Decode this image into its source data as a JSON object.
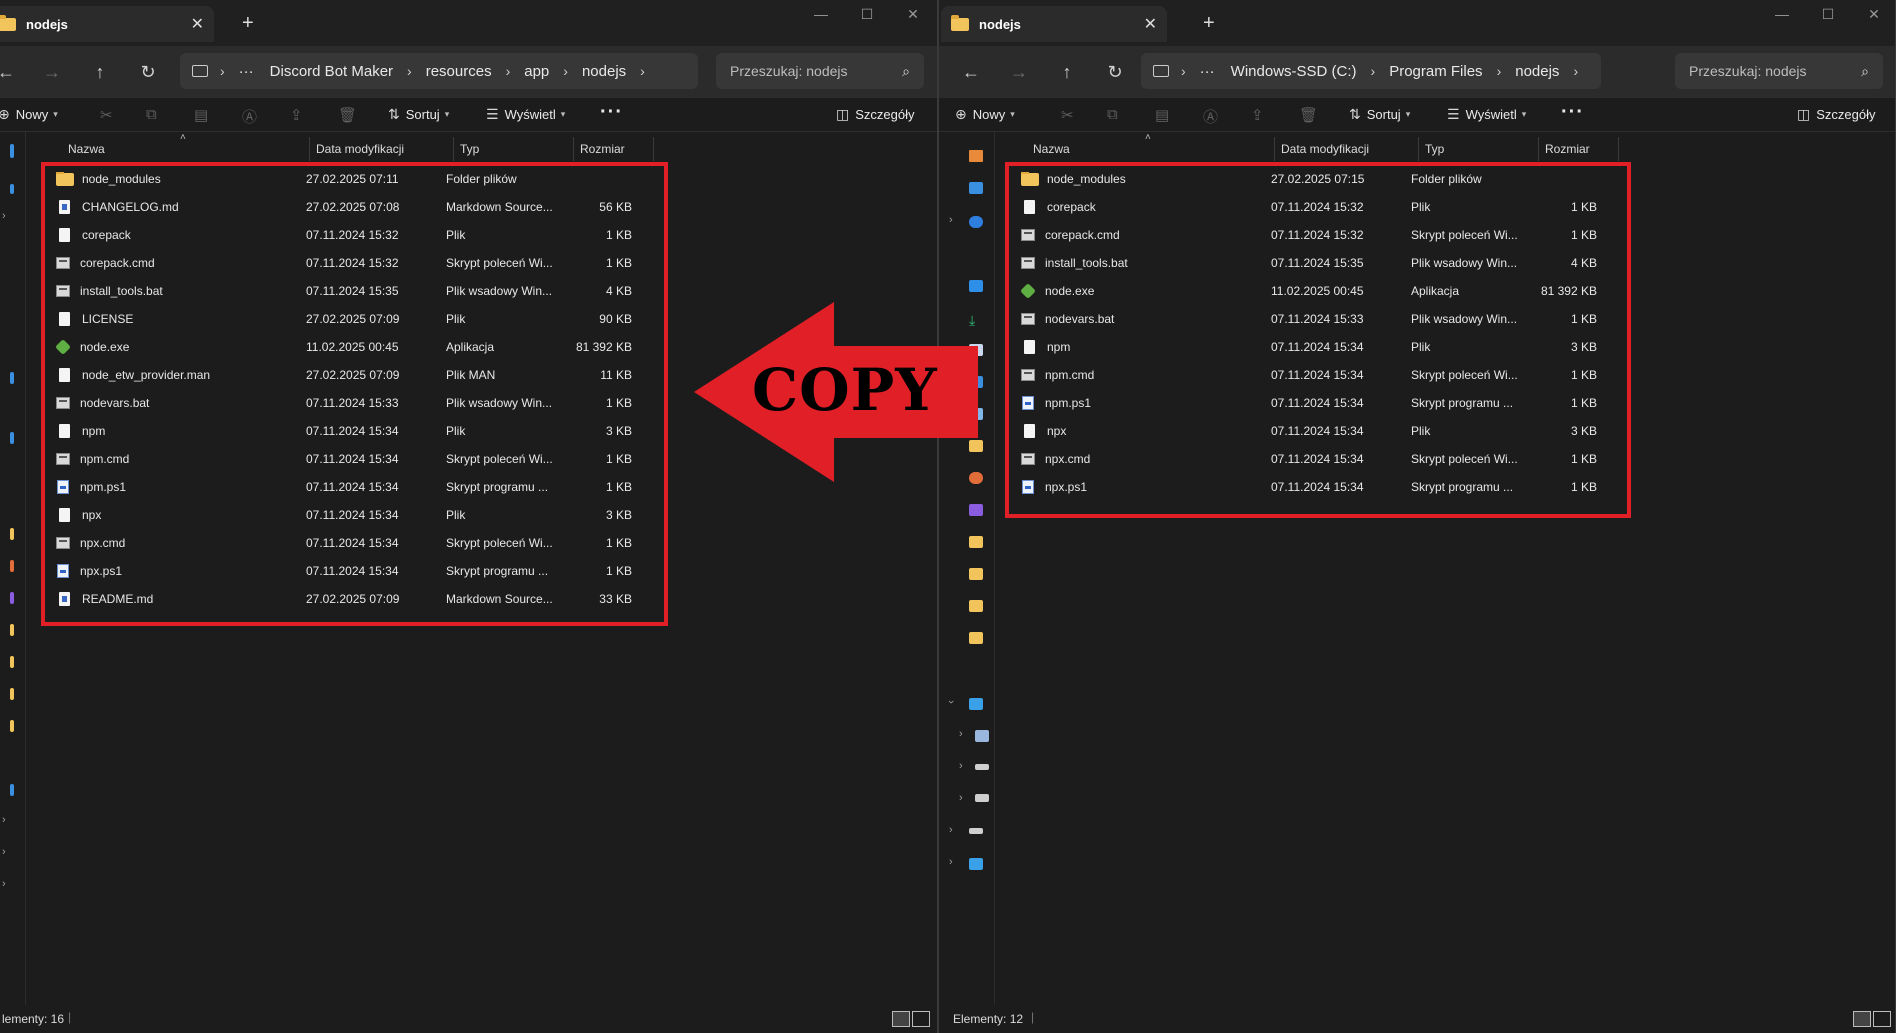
{
  "left": {
    "tab_title": "nodejs",
    "breadcrumb": [
      "Discord Bot Maker",
      "resources",
      "app",
      "nodejs"
    ],
    "search_placeholder": "Przeszukaj: nodejs",
    "toolbar": {
      "new": "Nowy",
      "sort": "Sortuj",
      "view": "Wyświetl",
      "details": "Szczegóły"
    },
    "columns": {
      "name": "Nazwa",
      "date": "Data modyfikacji",
      "type": "Typ",
      "size": "Rozmiar"
    },
    "files": [
      {
        "name": "node_modules",
        "date": "27.02.2025 07:11",
        "type": "Folder plików",
        "size": "",
        "icon": "folder"
      },
      {
        "name": "CHANGELOG.md",
        "date": "27.02.2025 07:08",
        "type": "Markdown Source...",
        "size": "56 KB",
        "icon": "md"
      },
      {
        "name": "corepack",
        "date": "07.11.2024 15:32",
        "type": "Plik",
        "size": "1 KB",
        "icon": "file"
      },
      {
        "name": "corepack.cmd",
        "date": "07.11.2024 15:32",
        "type": "Skrypt poleceń Wi...",
        "size": "1 KB",
        "icon": "script"
      },
      {
        "name": "install_tools.bat",
        "date": "07.11.2024 15:35",
        "type": "Plik wsadowy Win...",
        "size": "4 KB",
        "icon": "script"
      },
      {
        "name": "LICENSE",
        "date": "27.02.2025 07:09",
        "type": "Plik",
        "size": "90 KB",
        "icon": "file"
      },
      {
        "name": "node.exe",
        "date": "11.02.2025 00:45",
        "type": "Aplikacja",
        "size": "81 392 KB",
        "icon": "exe"
      },
      {
        "name": "node_etw_provider.man",
        "date": "27.02.2025 07:09",
        "type": "Plik MAN",
        "size": "11 KB",
        "icon": "file"
      },
      {
        "name": "nodevars.bat",
        "date": "07.11.2024 15:33",
        "type": "Plik wsadowy Win...",
        "size": "1 KB",
        "icon": "script"
      },
      {
        "name": "npm",
        "date": "07.11.2024 15:34",
        "type": "Plik",
        "size": "3 KB",
        "icon": "file"
      },
      {
        "name": "npm.cmd",
        "date": "07.11.2024 15:34",
        "type": "Skrypt poleceń Wi...",
        "size": "1 KB",
        "icon": "script"
      },
      {
        "name": "npm.ps1",
        "date": "07.11.2024 15:34",
        "type": "Skrypt programu ...",
        "size": "1 KB",
        "icon": "ps1"
      },
      {
        "name": "npx",
        "date": "07.11.2024 15:34",
        "type": "Plik",
        "size": "3 KB",
        "icon": "file"
      },
      {
        "name": "npx.cmd",
        "date": "07.11.2024 15:34",
        "type": "Skrypt poleceń Wi...",
        "size": "1 KB",
        "icon": "script"
      },
      {
        "name": "npx.ps1",
        "date": "07.11.2024 15:34",
        "type": "Skrypt programu ...",
        "size": "1 KB",
        "icon": "ps1"
      },
      {
        "name": "README.md",
        "date": "27.02.2025 07:09",
        "type": "Markdown Source...",
        "size": "33 KB",
        "icon": "md"
      }
    ],
    "status": "lementy: 16"
  },
  "right": {
    "tab_title": "nodejs",
    "breadcrumb": [
      "Windows-SSD (C:)",
      "Program Files",
      "nodejs"
    ],
    "search_placeholder": "Przeszukaj: nodejs",
    "toolbar": {
      "new": "Nowy",
      "sort": "Sortuj",
      "view": "Wyświetl",
      "details": "Szczegóły"
    },
    "columns": {
      "name": "Nazwa",
      "date": "Data modyfikacji",
      "type": "Typ",
      "size": "Rozmiar"
    },
    "files": [
      {
        "name": "node_modules",
        "date": "27.02.2025 07:15",
        "type": "Folder plików",
        "size": "",
        "icon": "folder"
      },
      {
        "name": "corepack",
        "date": "07.11.2024 15:32",
        "type": "Plik",
        "size": "1 KB",
        "icon": "file"
      },
      {
        "name": "corepack.cmd",
        "date": "07.11.2024 15:32",
        "type": "Skrypt poleceń Wi...",
        "size": "1 KB",
        "icon": "script"
      },
      {
        "name": "install_tools.bat",
        "date": "07.11.2024 15:35",
        "type": "Plik wsadowy Win...",
        "size": "4 KB",
        "icon": "script"
      },
      {
        "name": "node.exe",
        "date": "11.02.2025 00:45",
        "type": "Aplikacja",
        "size": "81 392 KB",
        "icon": "exe"
      },
      {
        "name": "nodevars.bat",
        "date": "07.11.2024 15:33",
        "type": "Plik wsadowy Win...",
        "size": "1 KB",
        "icon": "script"
      },
      {
        "name": "npm",
        "date": "07.11.2024 15:34",
        "type": "Plik",
        "size": "3 KB",
        "icon": "file"
      },
      {
        "name": "npm.cmd",
        "date": "07.11.2024 15:34",
        "type": "Skrypt poleceń Wi...",
        "size": "1 KB",
        "icon": "script"
      },
      {
        "name": "npm.ps1",
        "date": "07.11.2024 15:34",
        "type": "Skrypt programu ...",
        "size": "1 KB",
        "icon": "ps1"
      },
      {
        "name": "npx",
        "date": "07.11.2024 15:34",
        "type": "Plik",
        "size": "3 KB",
        "icon": "file"
      },
      {
        "name": "npx.cmd",
        "date": "07.11.2024 15:34",
        "type": "Skrypt poleceń Wi...",
        "size": "1 KB",
        "icon": "script"
      },
      {
        "name": "npx.ps1",
        "date": "07.11.2024 15:34",
        "type": "Skrypt programu ...",
        "size": "1 KB",
        "icon": "ps1"
      }
    ],
    "status": "Elementy: 12"
  },
  "annotation": {
    "label": "COPY",
    "color": "#e01f27"
  },
  "colors": {
    "highlight": "#e01f27",
    "background": "#1c1c1c",
    "folder": "#f2c55c"
  }
}
